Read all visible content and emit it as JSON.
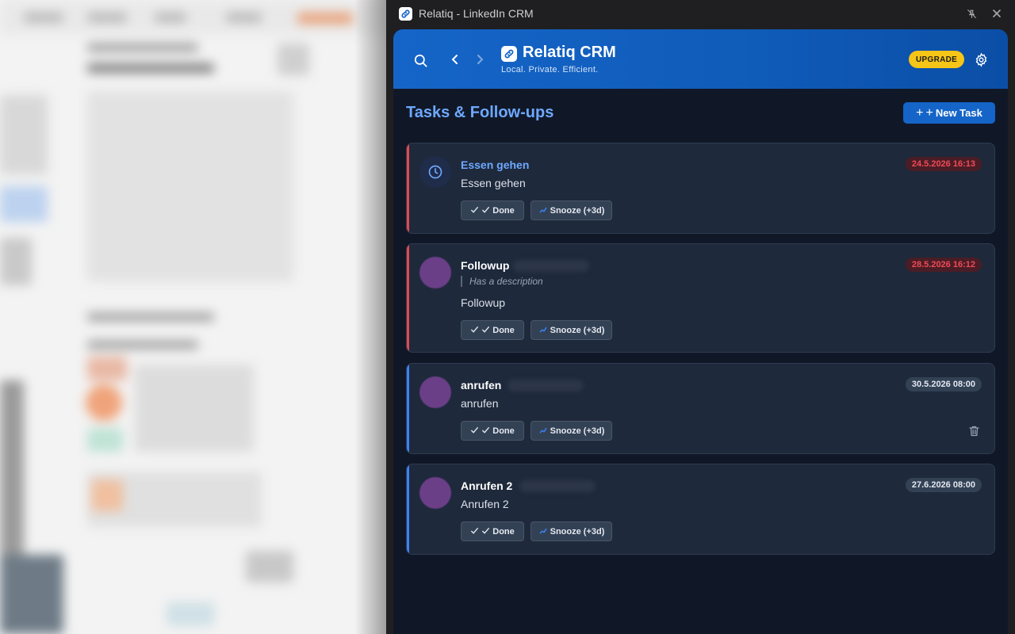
{
  "window": {
    "title": "Relatiq - LinkedIn CRM"
  },
  "header": {
    "brand_title": "Relatiq CRM",
    "brand_subtitle": "Local. Private. Efficient.",
    "upgrade_label": "UPGRADE"
  },
  "main": {
    "section_title": "Tasks & Follow-ups",
    "new_task_label": "New Task",
    "plus_glyph": "+",
    "tasks": [
      {
        "name": "Essen gehen",
        "description": "Essen gehen",
        "date": "24.5.2026 16:13",
        "status": "overdue",
        "done_label": "Done",
        "snooze_label": "Snooze (+3d)"
      },
      {
        "name": "Followup",
        "meta": "Has a description",
        "description": "Followup",
        "date": "28.5.2026 16:12",
        "status": "overdue",
        "done_label": "Done",
        "snooze_label": "Snooze (+3d)"
      },
      {
        "name": "anrufen",
        "description": "anrufen",
        "date": "30.5.2026 08:00",
        "status": "upcoming",
        "done_label": "Done",
        "snooze_label": "Snooze (+3d)"
      },
      {
        "name": "Anrufen 2",
        "description": "Anrufen 2",
        "date": "27.6.2026 08:00",
        "status": "upcoming",
        "done_label": "Done",
        "snooze_label": "Snooze (+3d)"
      }
    ]
  },
  "colors": {
    "accent": "#1565c8",
    "overdue": "#ef4a56",
    "upcoming_bar": "#3b82f6",
    "upgrade": "#f5c518"
  },
  "icons": [
    "link-icon",
    "pin-icon",
    "close-icon",
    "search-icon",
    "chevron-left-icon",
    "chevron-right-icon",
    "gear-icon",
    "plus-icon",
    "clock-icon",
    "check-icon",
    "snooze-icon",
    "trash-icon"
  ]
}
